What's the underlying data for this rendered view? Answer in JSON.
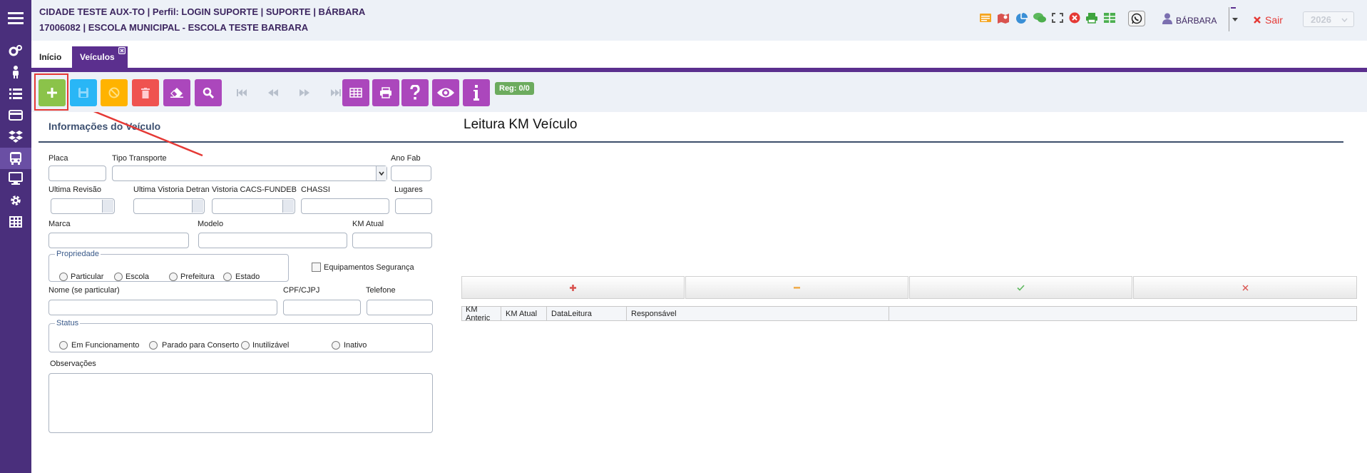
{
  "header": {
    "line1": "CIDADE TESTE AUX-TO | Perfil: LOGIN SUPORTE | SUPORTE | BÁRBARA",
    "line2": "17006082 | ESCOLA MUNICIPAL - ESCOLA TESTE BARBARA",
    "user": "BÁRBARA",
    "logout": "Sair",
    "year": "2026"
  },
  "tabs": {
    "home": "Início",
    "vehicles": "Veículos"
  },
  "toolbar": {
    "reg": "Reg: 0/0"
  },
  "form": {
    "title": "Informações do Veículo",
    "placa": "Placa",
    "tipo_transporte": "Tipo Transporte",
    "ano_fab": "Ano Fab",
    "ultima_revisao": "Ultima Revisão",
    "ultima_vistoria": "Ultima Vistoria Detran",
    "vistoria_cacs": "Vistoria CACS-FUNDEB",
    "chassi": "CHASSI",
    "lugares": "Lugares",
    "marca": "Marca",
    "modelo": "Modelo",
    "km_atual": "KM Atual",
    "propriedade": {
      "legend": "Propriedade",
      "options": [
        "Particular",
        "Escola",
        "Prefeitura",
        "Estado"
      ]
    },
    "equipamentos": "Equipamentos Segurança",
    "nome": "Nome (se particular)",
    "cpf": "CPF/CJPJ",
    "telefone": "Telefone",
    "status": {
      "legend": "Status",
      "options": [
        "Em Funcionamento",
        "Parado para Conserto",
        "Inutilizável",
        "Inativo"
      ]
    },
    "observacoes": "Observações"
  },
  "km": {
    "title": "Leitura KM Veículo",
    "columns": [
      "KM Anteric",
      "KM Atual",
      "DataLeitura",
      "Responsável"
    ]
  },
  "colors": {
    "sidebar": "#4a2f7c",
    "accent": "#5b2f8e",
    "add": "#8bc34a",
    "save": "#29b6f6",
    "cancel": "#ffb300",
    "delete": "#ef5350",
    "purple_btn": "#ab47bc"
  }
}
